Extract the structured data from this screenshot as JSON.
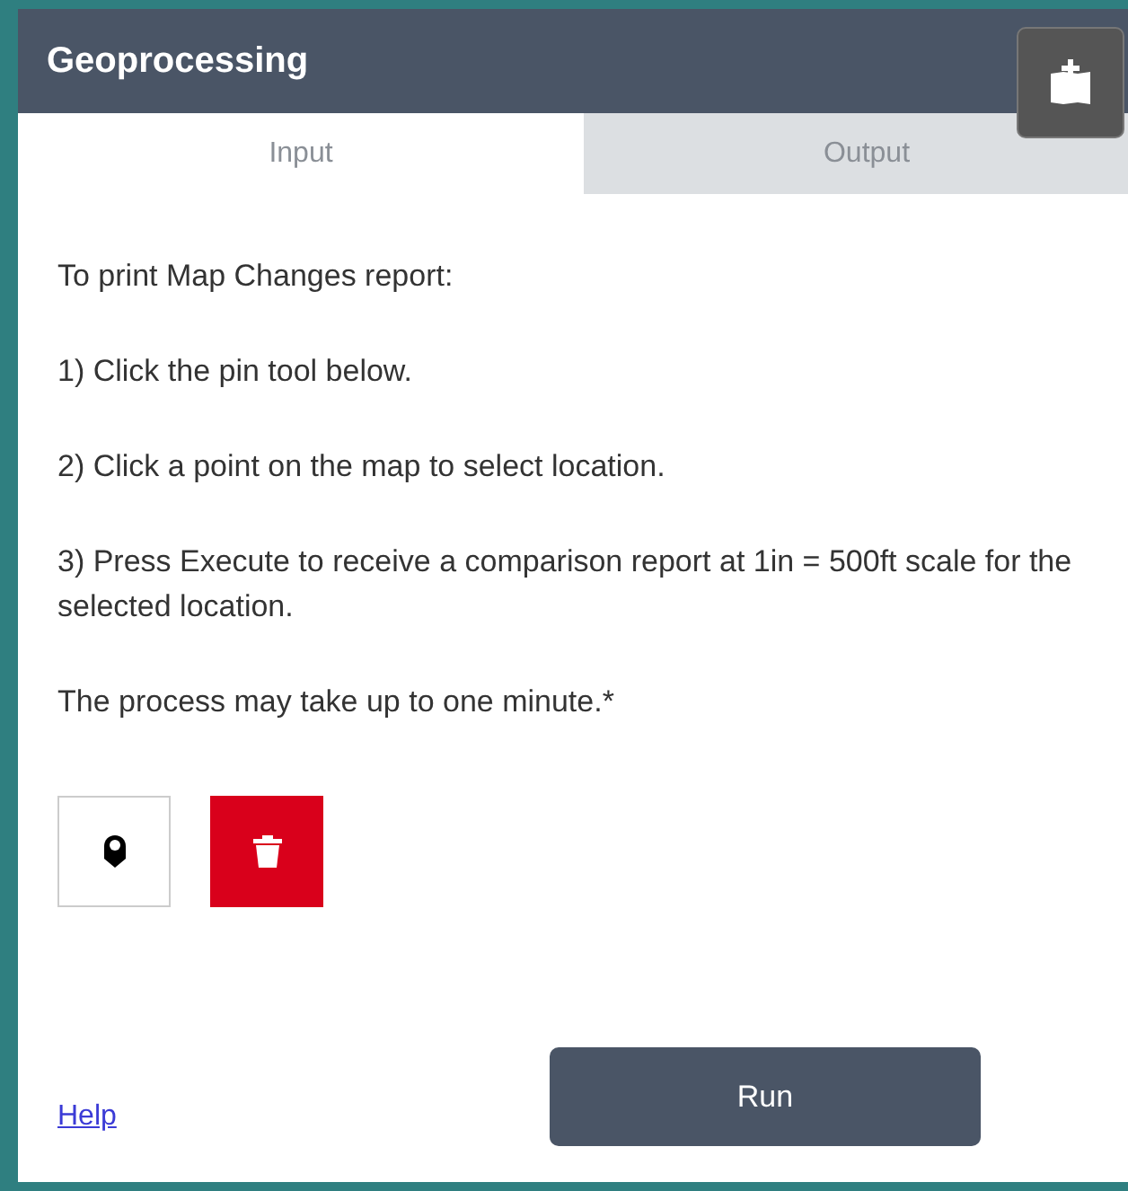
{
  "panel": {
    "title": "Geoprocessing"
  },
  "tabs": [
    {
      "label": "Input",
      "selected": true
    },
    {
      "label": "Output",
      "selected": false
    }
  ],
  "instructions": [
    "To print Map Changes report:",
    "1) Click the pin tool below.",
    "2) Click a point on the map to select location.",
    "3) Press Execute to receive a comparison report at 1in = 500ft scale for the selected location.",
    "The process may take up to one minute.*"
  ],
  "tools": [
    {
      "kind": "pin"
    },
    {
      "kind": "delete"
    }
  ],
  "footer": {
    "link": "Help",
    "button": "Run"
  }
}
